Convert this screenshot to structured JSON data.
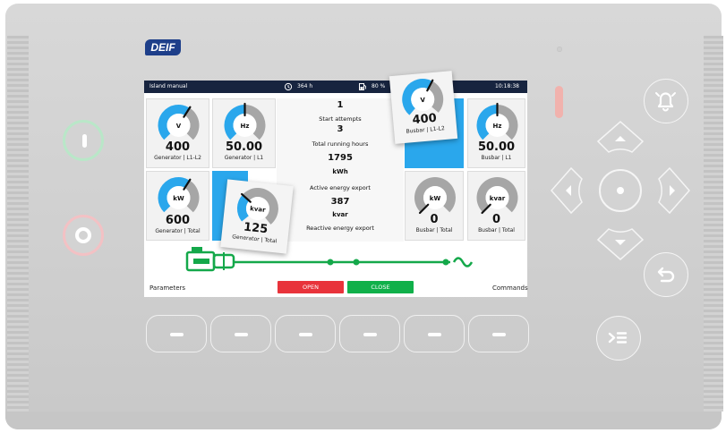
{
  "brand": {
    "logo_text": "DEIF"
  },
  "status": {
    "mode": "Island manual",
    "hours": "364 h",
    "fuel": "80 %",
    "time": "10:18:38"
  },
  "gauges": {
    "gen_voltage": {
      "unit": "V",
      "value": "400",
      "label": "Generator | L1-L2",
      "fill": 0.62
    },
    "gen_freq": {
      "unit": "Hz",
      "value": "50.00",
      "label": "Generator | L1",
      "fill": 0.5
    },
    "gen_kw": {
      "unit": "kW",
      "value": "600",
      "label": "Generator | Total",
      "fill": 0.62
    },
    "gen_kvar": {
      "unit": "kvar",
      "value": "125",
      "label": "Generator | Total",
      "fill": 0.3
    },
    "bus_voltage": {
      "unit": "V",
      "value": "400",
      "label": "Busbar | L1-L2",
      "fill": 0.62
    },
    "bus_freq": {
      "unit": "Hz",
      "value": "50.00",
      "label": "Busbar | L1",
      "fill": 0.5
    },
    "bus_kw": {
      "unit": "kW",
      "value": "0",
      "label": "Busbar | Total",
      "fill": 0
    },
    "bus_kvar": {
      "unit": "kvar",
      "value": "0",
      "label": "Busbar | Total",
      "fill": 0
    }
  },
  "counters": {
    "top_value": "1",
    "start_attempts_label": "Start attempts",
    "start_attempts_value": "3",
    "running_hours_label": "Total running hours",
    "running_hours_value": "1795",
    "kwh_unit": "kWh",
    "active_export_label": "Active energy export",
    "active_export_value": "387",
    "kvar_unit": "kvar",
    "reactive_export_label": "Reactive energy export"
  },
  "commands": {
    "open": "OPEN",
    "close": "CLOSE",
    "parameters": "Parameters",
    "commands_label": "Commands"
  },
  "colors": {
    "gauge_blue": "#2aa7ec",
    "gauge_grey": "#a6a6a6",
    "open_red": "#e8333b",
    "close_green": "#10b04a",
    "diagram_green": "#14a84a",
    "statusbar": "#17243f"
  },
  "icons": [
    "start-icon",
    "stop-icon",
    "alarm-bell-icon",
    "arrow-up-icon",
    "arrow-down-icon",
    "arrow-left-icon",
    "arrow-right-icon",
    "enter-icon",
    "back-icon",
    "jump-menu-icon",
    "hours-icon",
    "fuel-icon",
    "generator-icon",
    "sine-wave-icon"
  ]
}
